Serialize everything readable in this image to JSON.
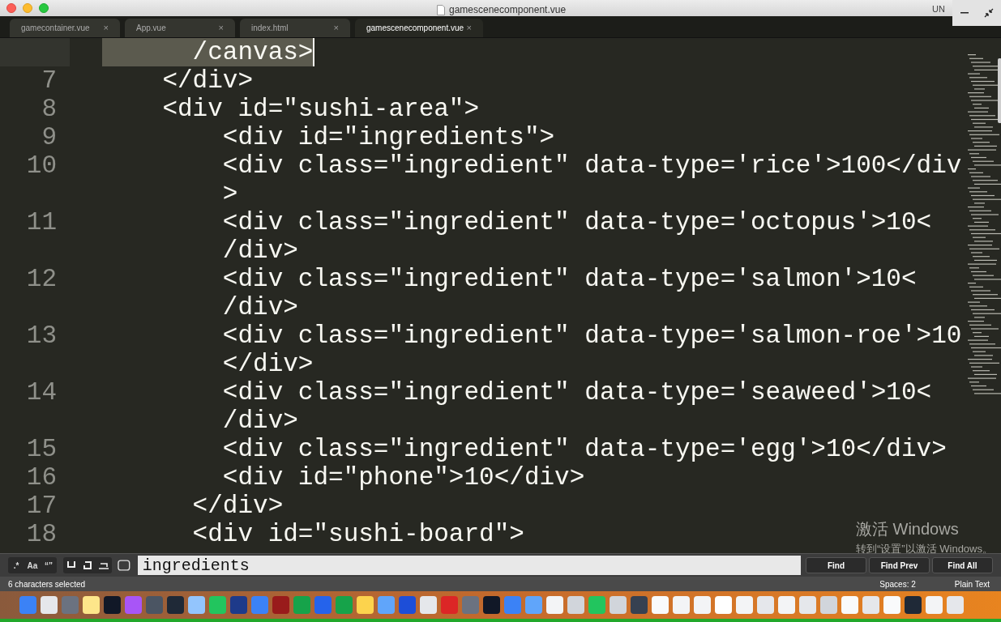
{
  "window": {
    "title": "gamescenecomponent.vue",
    "title_right": "UN"
  },
  "tabs": [
    {
      "label": "gamecontainer.vue",
      "close": "×",
      "selected": false
    },
    {
      "label": "App.vue",
      "close": "×",
      "selected": false
    },
    {
      "label": "index.html",
      "close": "×",
      "selected": false
    },
    {
      "label": "gamescenecomponent.vue",
      "close": "×",
      "selected": true
    }
  ],
  "editor": {
    "lines": [
      {
        "rows": [
          "      /canvas>"
        ],
        "selected": true
      },
      {
        "number": "7",
        "rows": [
          "    </div>"
        ],
        "selected": false
      },
      {
        "number": "8",
        "rows": [
          "    <div id=\"sushi-area\">"
        ],
        "selected": false
      },
      {
        "number": "9",
        "rows": [
          "        <div id=\"ingredients\">"
        ],
        "selected": false
      },
      {
        "number": "10",
        "rows": [
          "        <div class=\"ingredient\" data-type='rice'>100</div",
          "        >"
        ],
        "selected": false
      },
      {
        "number": "11",
        "rows": [
          "        <div class=\"ingredient\" data-type='octopus'>10<",
          "        /div>"
        ],
        "selected": false
      },
      {
        "number": "12",
        "rows": [
          "        <div class=\"ingredient\" data-type='salmon'>10<",
          "        /div>"
        ],
        "selected": false
      },
      {
        "number": "13",
        "rows": [
          "        <div class=\"ingredient\" data-type='salmon-roe'>10",
          "        </div>"
        ],
        "selected": false
      },
      {
        "number": "14",
        "rows": [
          "        <div class=\"ingredient\" data-type='seaweed'>10<",
          "        /div>"
        ],
        "selected": false
      },
      {
        "number": "15",
        "rows": [
          "        <div class=\"ingredient\" data-type='egg'>10</div>"
        ],
        "selected": false
      },
      {
        "number": "16",
        "rows": [
          "        <div id=\"phone\">10</div>"
        ],
        "selected": false
      },
      {
        "number": "17",
        "rows": [
          "      </div>"
        ],
        "selected": false
      },
      {
        "number": "18",
        "rows": [
          "      <div id=\"sushi-board\">"
        ],
        "selected": false
      }
    ],
    "activation": {
      "title": "激活 Windows",
      "subtitle": "转到“设置”以激活 Windows。"
    }
  },
  "find_panel": {
    "option_buttons": [
      {
        "label": ".*",
        "on": false
      },
      {
        "label": "Aa",
        "on": false
      },
      {
        "label": "“”",
        "on": false
      }
    ],
    "value": "ingredients",
    "buttons": [
      "Find",
      "Find Prev",
      "Find All"
    ]
  },
  "status_bar": {
    "selection": "6 characters selected",
    "indentation": "Spaces: 2",
    "syntax": "Plain Text"
  }
}
